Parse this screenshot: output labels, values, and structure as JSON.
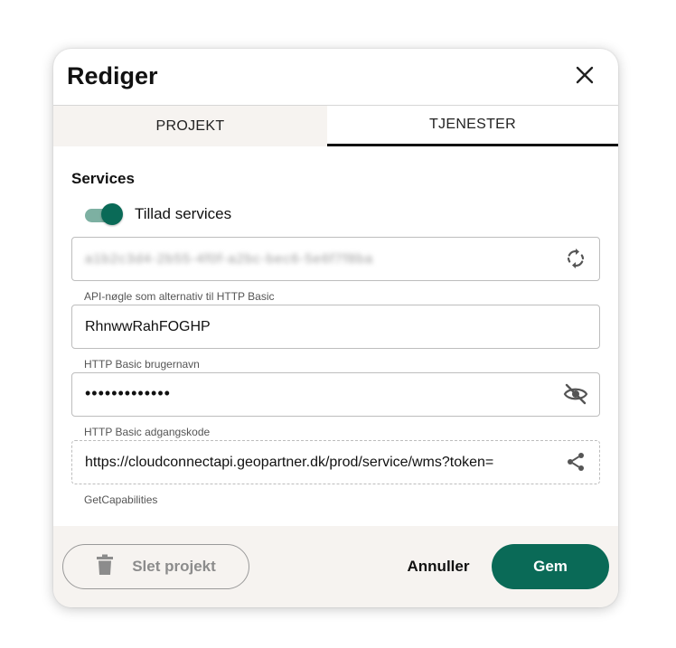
{
  "dialog": {
    "title": "Rediger",
    "close_icon": "close-icon"
  },
  "tabs": [
    {
      "label": "PROJEKT",
      "active": false
    },
    {
      "label": "TJENESTER",
      "active": true
    }
  ],
  "services": {
    "section_title": "Services",
    "toggle": {
      "label": "Tillad services",
      "checked": true
    },
    "api_key": {
      "value": "a1b2c3d4-2b55-4f0f-a2bc-bec6-5e6f7f8ba",
      "helper": "API-nøgle som alternativ til HTTP Basic",
      "icon": "refresh-icon"
    },
    "username": {
      "value": "RhnwwRahFOGHP",
      "helper": "HTTP Basic brugernavn"
    },
    "password": {
      "value": "•••••••••••••",
      "helper": "HTTP Basic adgangskode",
      "icon": "eye-off-icon"
    },
    "capabilities": {
      "value": "https://cloudconnectapi.geopartner.dk/prod/service/wms?token=",
      "helper": "GetCapabilities",
      "icon": "share-icon"
    }
  },
  "footer": {
    "delete_label": "Slet projekt",
    "delete_icon": "trash-icon",
    "cancel_label": "Annuller",
    "save_label": "Gem"
  },
  "colors": {
    "accent": "#0a6a57",
    "toggle_track": "#7db0a2",
    "footer_bg": "#f6f3f0"
  }
}
